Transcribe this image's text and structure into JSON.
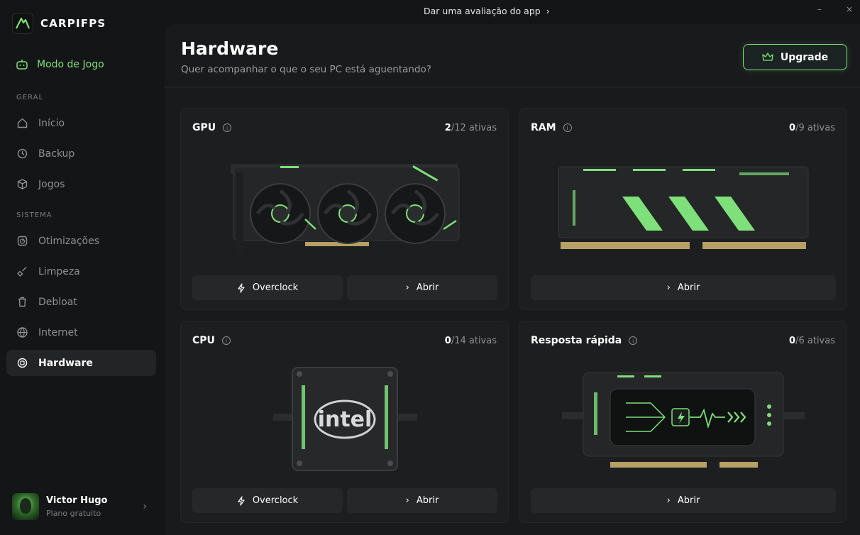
{
  "app": {
    "name": "CARPIFPS"
  },
  "topbar": {
    "review_text": "Dar uma avaliação do app",
    "minimize": "–",
    "close": "×"
  },
  "sidebar": {
    "game_mode": "Modo de Jogo",
    "sections": [
      {
        "label": "GERAL",
        "items": [
          {
            "label": "Início",
            "icon": "home-icon"
          },
          {
            "label": "Backup",
            "icon": "backup-icon"
          },
          {
            "label": "Jogos",
            "icon": "cube-icon"
          }
        ]
      },
      {
        "label": "SISTEMA",
        "items": [
          {
            "label": "Otimizações",
            "icon": "gauge-icon"
          },
          {
            "label": "Limpeza",
            "icon": "broom-icon"
          },
          {
            "label": "Debloat",
            "icon": "trash-icon"
          },
          {
            "label": "Internet",
            "icon": "globe-icon"
          },
          {
            "label": "Hardware",
            "icon": "chip-icon",
            "active": true
          }
        ]
      }
    ]
  },
  "user": {
    "name": "Victor Hugo",
    "plan": "Plano gratuito"
  },
  "header": {
    "title": "Hardware",
    "subtitle": "Quer acompanhar o que o seu PC está aguentando?",
    "upgrade": "Upgrade"
  },
  "cards": {
    "gpu": {
      "title": "GPU",
      "active": "2",
      "total": "/12 ativas",
      "btn1": "Overclock",
      "btn2": "Abrir"
    },
    "ram": {
      "title": "RAM",
      "active": "0",
      "total": "/9 ativas",
      "btn1": "Abrir"
    },
    "cpu": {
      "title": "CPU",
      "active": "0",
      "total": "/14 ativas",
      "btn1": "Overclock",
      "btn2": "Abrir",
      "chip_label": "intel"
    },
    "quick": {
      "title": "Resposta rápida",
      "active": "0",
      "total": "/6 ativas",
      "btn1": "Abrir"
    }
  },
  "colors": {
    "accent": "#7ee07a",
    "bg": "#141516",
    "panel": "#181a1b",
    "card": "#1c1e1f"
  }
}
